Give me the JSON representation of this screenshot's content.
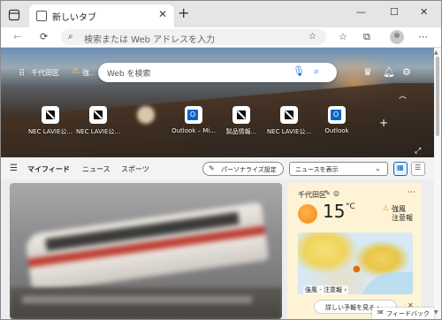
{
  "tab": {
    "title": "新しいタブ",
    "close": "✕"
  },
  "window": {
    "new_tab": "+",
    "minimize": "—",
    "maximize": "☐",
    "close": "✕"
  },
  "toolbar": {
    "back": "←",
    "reload": "⟳",
    "address_placeholder": "検索または Web アドレスを入力",
    "favorite_add": "☆",
    "favorites": "☆",
    "collections": "⧉"
  },
  "hero": {
    "location": "千代田区",
    "weather_short": "強..",
    "search_placeholder": "Web を検索",
    "tiles": [
      {
        "label": "NEC LAVIE公..."
      },
      {
        "label": "NEC LAVIE公..."
      },
      {
        "label": ""
      },
      {
        "label": "Outlook – Mi..."
      },
      {
        "label": "製品情報..."
      },
      {
        "label": "NEC LAVIE公..."
      },
      {
        "label": "Outlook"
      }
    ]
  },
  "feednav": {
    "myfeed": "マイフィード",
    "news": "ニュース",
    "sports": "スポーツ",
    "personalize": "パーソナライズ設定",
    "newsview": "ニュースを表示"
  },
  "weather": {
    "location": "千代田区",
    "temp": "15",
    "unit": "°C",
    "alert_line1": "強風",
    "alert_line2": "注意報",
    "map_alert": "強風 - 注意報 ›",
    "forecast_button": "詳しい予報を見る ›"
  },
  "feedback": {
    "label": "フィードバック"
  },
  "colors": {
    "accent": "#0a64c8",
    "weather_bg": "#fff3d6",
    "sun": "#f08c1c"
  }
}
